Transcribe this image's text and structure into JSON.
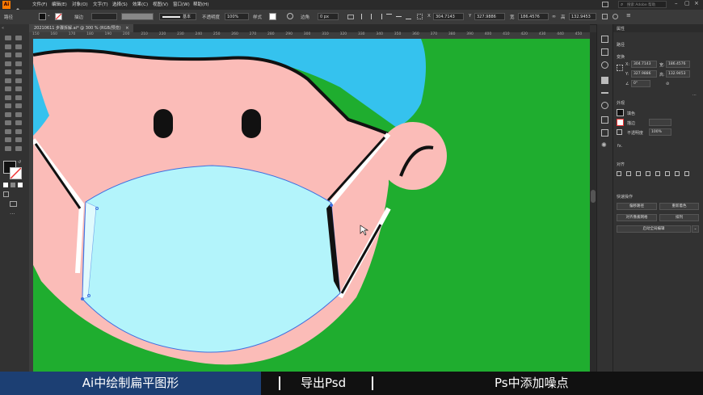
{
  "menubar": {
    "app_logo": "Ai",
    "items": [
      "文件(F)",
      "编辑(E)",
      "对象(O)",
      "文字(T)",
      "选择(S)",
      "效果(C)",
      "视图(V)",
      "窗口(W)",
      "帮助(H)"
    ],
    "search_placeholder": "搜索 Adobe 帮助"
  },
  "controlbar": {
    "selection_label": "路径",
    "stroke_label": "描边",
    "stroke_style": "基本",
    "opacity_label": "不透明度",
    "opacity_value": "100%",
    "style_label": "样式",
    "corner_label": "边角",
    "corner_value": "0 px",
    "x_label": "X",
    "x_value": "304.7143",
    "y_label": "Y",
    "y_value": "327.9886",
    "w_label": "宽",
    "w_value": "186.4576",
    "h_label": "高",
    "h_value": "132.9453"
  },
  "document_tab": {
    "title": "20210611 步骤拆解.ai* @ 300 % (RGB/预览)",
    "close": "×"
  },
  "ruler": {
    "h_ticks": [
      "150",
      "160",
      "170",
      "180",
      "190",
      "200",
      "210",
      "220",
      "230",
      "240",
      "250",
      "260",
      "270",
      "280",
      "290",
      "300",
      "310",
      "320",
      "330",
      "340",
      "350",
      "360",
      "370",
      "380",
      "390",
      "400",
      "410",
      "420",
      "430",
      "440",
      "450"
    ]
  },
  "panel": {
    "tab_title": "属性",
    "section_path": "路径",
    "section_transform": "变换",
    "x_label": "X:",
    "x_value": "304.7143",
    "y_label": "Y:",
    "y_value": "327.9886",
    "w_label": "宽:",
    "w_value": "186.4576",
    "h_label": "高:",
    "h_value": "132.9453",
    "angle_value": "0°",
    "section_appearance": "外观",
    "fill_label": "填色",
    "stroke_label": "描边",
    "opacity_label": "不透明度",
    "opacity_value": "100%",
    "fx_label": "fx.",
    "section_align": "对齐",
    "section_quick": "快速操作",
    "btn_offset": "偏移路径",
    "btn_recolor": "重新着色",
    "btn_pixel": "对齐像素网格",
    "btn_arrange": "排列",
    "btn_global_edit": "启动全局编辑"
  },
  "caption": {
    "step1": "Ai中绘制扁平图形",
    "step2": "导出Psd",
    "step3": "Ps中添加噪点"
  },
  "colors": {
    "canvas_bg": "#1fad2f",
    "skin": "#fbbcb8",
    "hair": "#35c2ee",
    "mask": "#b3f4fb",
    "caption_active": "#1c3f73",
    "selection": "#3f6fe0"
  }
}
